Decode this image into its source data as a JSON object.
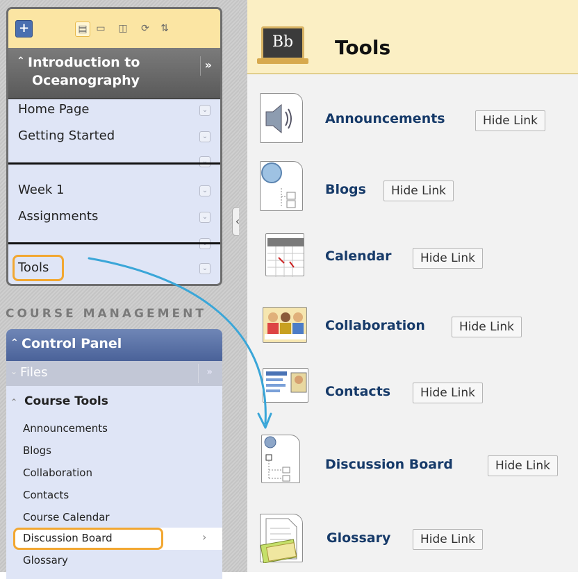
{
  "course_menu": {
    "title_line1": "Introduction to",
    "title_line2": "Oceanography",
    "items": [
      "Home Page",
      "Getting Started",
      "Week 1",
      "Assignments",
      "Tools"
    ]
  },
  "course_management": {
    "heading": "COURSE MANAGEMENT",
    "control_panel": "Control Panel",
    "files": "Files",
    "course_tools": "Course Tools",
    "items": [
      "Announcements",
      "Blogs",
      "Collaboration",
      "Contacts",
      "Course Calendar",
      "Discussion Board",
      "Glossary"
    ]
  },
  "page": {
    "logo": "Bb",
    "title": "Tools"
  },
  "tools": [
    {
      "label": "Announcements",
      "button": "Hide Link"
    },
    {
      "label": "Blogs",
      "button": "Hide Link"
    },
    {
      "label": "Calendar",
      "button": "Hide Link"
    },
    {
      "label": "Collaboration",
      "button": "Hide Link"
    },
    {
      "label": "Contacts",
      "button": "Hide Link"
    },
    {
      "label": "Discussion Board",
      "button": "Hide Link"
    },
    {
      "label": "Glossary",
      "button": "Hide Link"
    }
  ]
}
